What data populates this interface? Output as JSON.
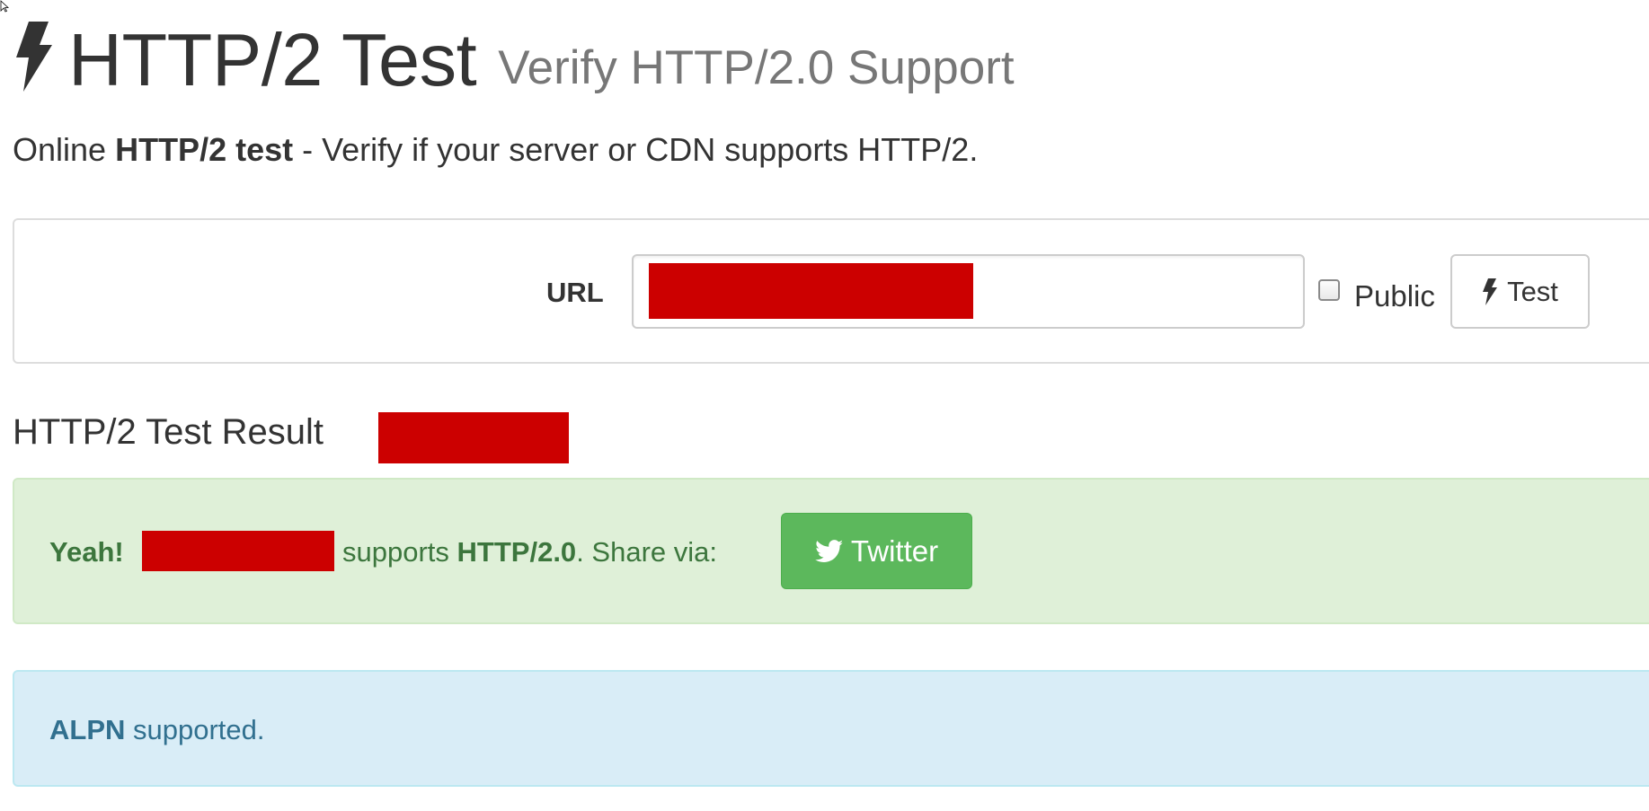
{
  "header": {
    "title": "HTTP/2 Test",
    "subtitle": "Verify HTTP/2.0 Support"
  },
  "lead": {
    "prefix": "Online",
    "bold": "HTTP/2 test",
    "suffix": "- Verify if your server or CDN supports HTTP/2."
  },
  "form": {
    "url_label": "URL",
    "url_value": "",
    "public_label": "Public",
    "public_checked": false,
    "test_button_label": "Test"
  },
  "result": {
    "heading": "HTTP/2 Test Result",
    "success": {
      "yeah": "Yeah!",
      "supports_word": "supports",
      "protocol": "HTTP/2.0",
      "share_text": ". Share via:",
      "twitter_label": "Twitter"
    },
    "info": {
      "alpn_bold": "ALPN",
      "alpn_text": "supported."
    }
  },
  "colors": {
    "redaction": "#cc0000",
    "success_bg": "#dff0d8",
    "success_text": "#3c763d",
    "info_bg": "#d9edf7",
    "info_text": "#31708f",
    "twitter_button": "#5cb85c"
  },
  "icons": {
    "title_icon": "lightning-bolt-icon",
    "test_button_icon": "lightning-bolt-icon",
    "twitter_button_icon": "twitter-bird-icon"
  }
}
